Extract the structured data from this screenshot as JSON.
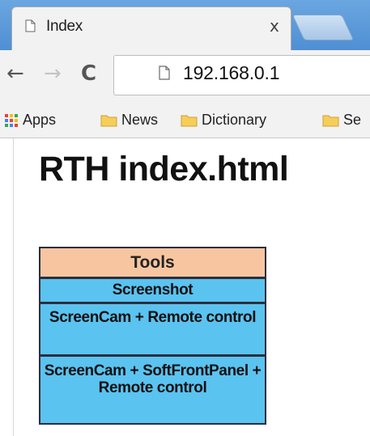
{
  "browser": {
    "tab": {
      "title": "Index",
      "close": "x"
    },
    "toolbar": {
      "back": "←",
      "forward": "→",
      "reload": "C",
      "url": "192.168.0.1"
    },
    "bookmarks": [
      {
        "label": "Apps",
        "icon": "apps-grid-icon"
      },
      {
        "label": "News",
        "icon": "folder-icon"
      },
      {
        "label": "Dictionary",
        "icon": "folder-icon"
      },
      {
        "label": "Se",
        "icon": "folder-icon"
      }
    ]
  },
  "page": {
    "title": "RTH index.html",
    "tools": {
      "header": "Tools",
      "items": [
        {
          "label": "Screenshot"
        },
        {
          "label": "ScreenCam + Remote control"
        },
        {
          "label": "ScreenCam + SoftFrontPanel + Remote control"
        }
      ]
    }
  },
  "colors": {
    "tools_header_bg": "#f7c6a0",
    "tools_row_bg": "#5ac3f0",
    "tools_border": "#2d2d3e",
    "tabstrip_blue": "#5b9ad8"
  }
}
